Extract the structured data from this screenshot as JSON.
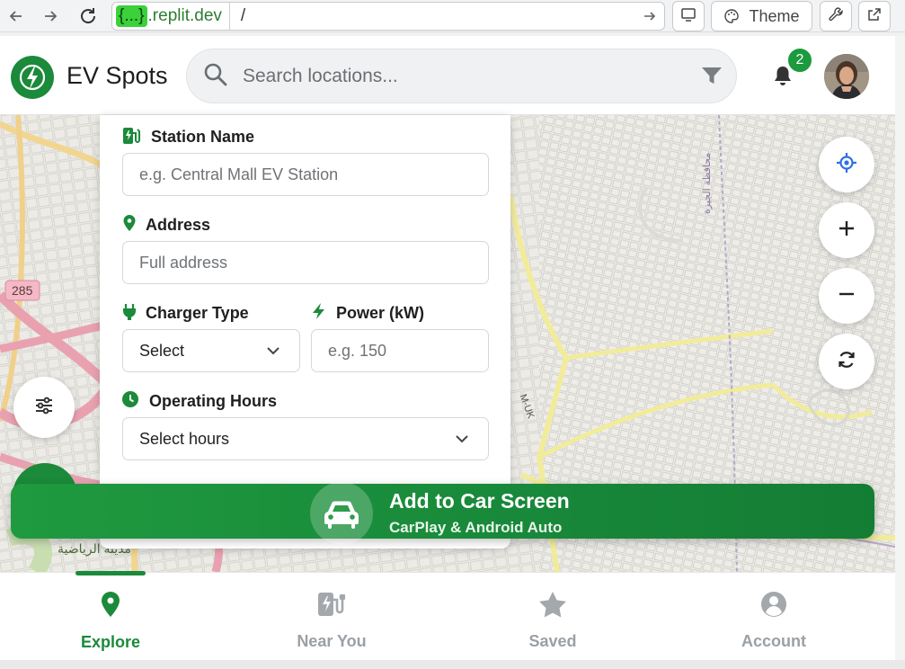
{
  "browser": {
    "url_host_highlight": "{...}",
    "url_host_rest": ".replit.dev",
    "url_path": "/",
    "theme_label": "Theme"
  },
  "header": {
    "title": "EV Spots",
    "search_placeholder": "Search locations...",
    "notification_count": "2",
    "brand_color": "#1b8a3a"
  },
  "form": {
    "station_name_label": "Station Name",
    "station_name_placeholder": "e.g. Central Mall EV Station",
    "address_label": "Address",
    "address_placeholder": "Full address",
    "charger_type_label": "Charger Type",
    "charger_type_value": "Select",
    "power_label": "Power (kW)",
    "power_placeholder": "e.g. 150",
    "hours_label": "Operating Hours",
    "hours_value": "Select hours"
  },
  "map": {
    "road_label": "285",
    "road_label_2": "M-UK",
    "arabic_label": "محافظة الجيزة",
    "arabic_label_2": "مدينة الرياضية"
  },
  "car_banner": {
    "title": "Add to Car Screen",
    "subtitle": "CarPlay & Android Auto"
  },
  "bottom_nav": {
    "items": [
      {
        "label": "Explore",
        "icon": "map-pin-icon",
        "active": true
      },
      {
        "label": "Near You",
        "icon": "ev-station-icon",
        "active": false
      },
      {
        "label": "Saved",
        "icon": "star-icon",
        "active": false
      },
      {
        "label": "Account",
        "icon": "user-icon",
        "active": false
      }
    ]
  }
}
